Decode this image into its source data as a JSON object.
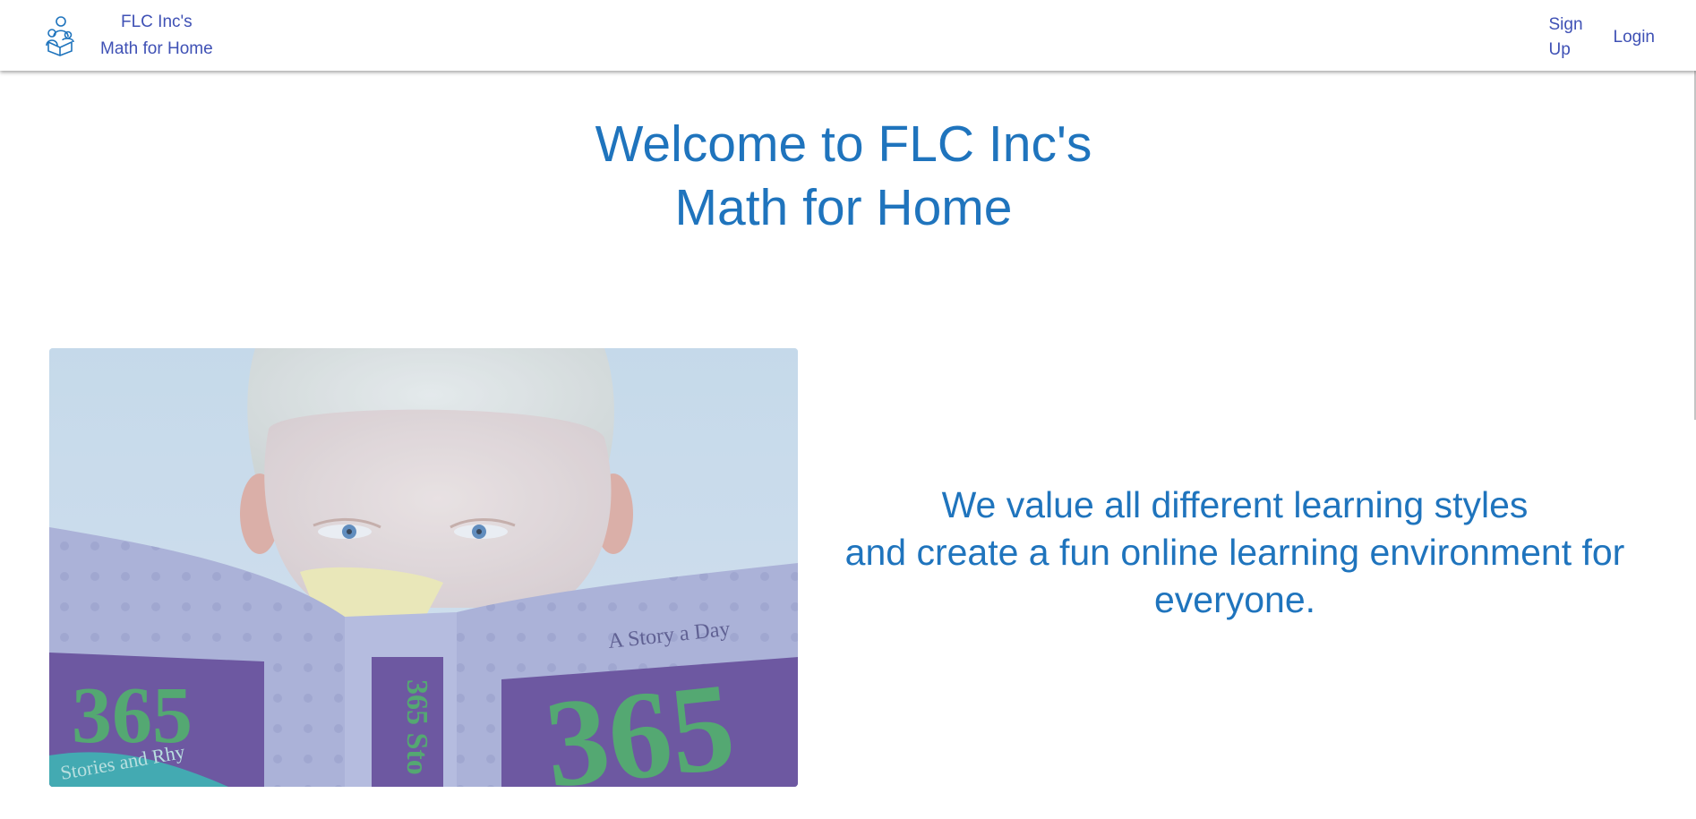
{
  "navbar": {
    "logo_icon": "family-reading-icon",
    "brand_line1": "FLC Inc's",
    "brand_line2": "Math for Home",
    "signup_label": "Sign Up",
    "login_label": "Login",
    "link_color": "#3f51b5"
  },
  "hero": {
    "title_line1": "Welcome to FLC Inc's",
    "title_line2": "Math for Home",
    "title_color": "#1f74bd"
  },
  "feature": {
    "image_subject": "child-reading-book-photo",
    "book_label_top": "A Story a Day",
    "book_number": "365",
    "book_spine": "365 Sto",
    "book_ribbon": "Stories and Rhy",
    "tagline_line1": "We value all different learning styles",
    "tagline_line2": "and create a fun online learning environment for everyone."
  }
}
